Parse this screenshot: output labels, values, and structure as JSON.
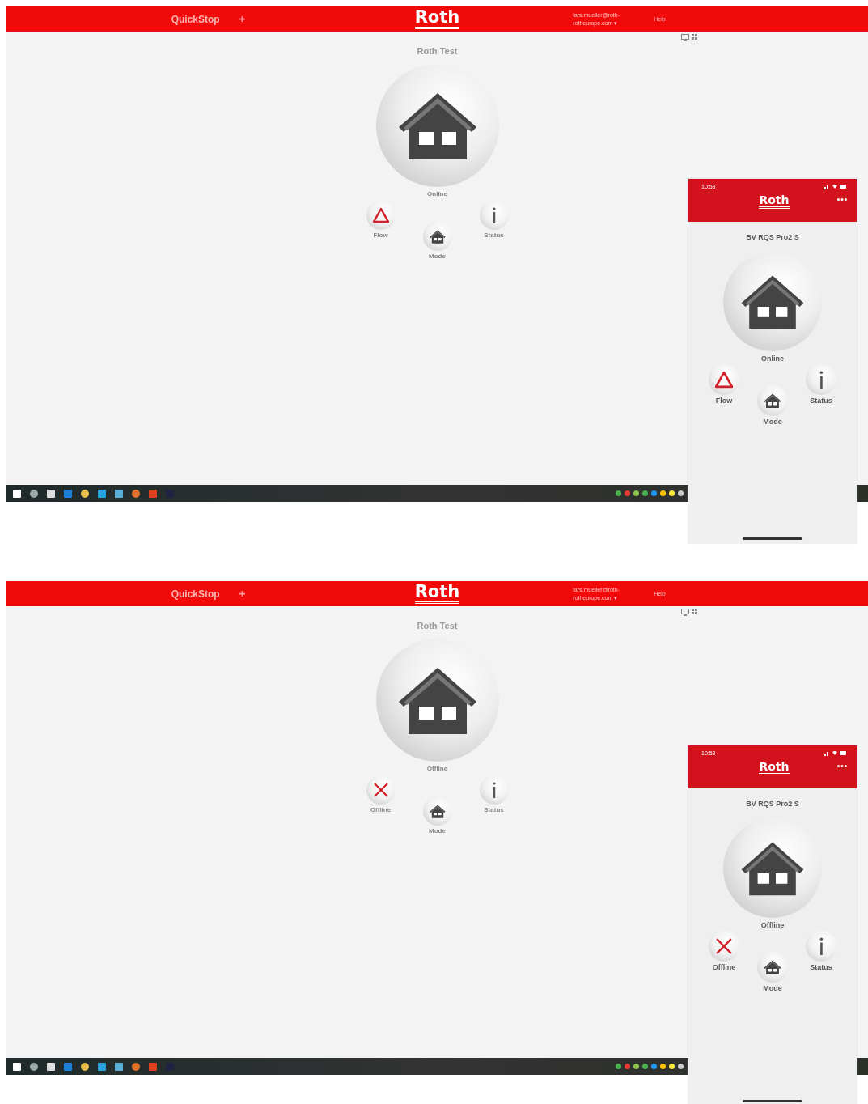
{
  "panels": [
    {
      "web": {
        "menu_item": "QuickStop",
        "logo": "Roth",
        "account": "lars.mueller@roth-rotheurope.com ▾",
        "help": "Help",
        "device_name": "Roth Test",
        "state": "Online",
        "buttons": [
          {
            "kind": "warning",
            "label": "Flow"
          },
          {
            "kind": "mode",
            "label": "Mode"
          },
          {
            "kind": "info",
            "label": "Status"
          }
        ]
      },
      "phone": {
        "time": "10:53",
        "logo": "Roth",
        "device_name": "BV RQS Pro2 S",
        "state": "Online",
        "buttons": [
          {
            "kind": "warning",
            "label": "Flow"
          },
          {
            "kind": "mode",
            "label": "Mode"
          },
          {
            "kind": "info",
            "label": "Status"
          }
        ]
      }
    },
    {
      "web": {
        "menu_item": "QuickStop",
        "logo": "Roth",
        "account": "lars.mueller@roth-rotheurope.com ▾",
        "help": "Help",
        "device_name": "Roth Test",
        "state": "Offline",
        "buttons": [
          {
            "kind": "error",
            "label": "Offline"
          },
          {
            "kind": "mode",
            "label": "Mode"
          },
          {
            "kind": "info",
            "label": "Status"
          }
        ]
      },
      "phone": {
        "time": "10:53",
        "logo": "Roth",
        "device_name": "BV RQS Pro2 S",
        "state": "Offline",
        "buttons": [
          {
            "kind": "error",
            "label": "Offline"
          },
          {
            "kind": "mode",
            "label": "Mode"
          },
          {
            "kind": "info",
            "label": "Status"
          }
        ]
      }
    }
  ]
}
